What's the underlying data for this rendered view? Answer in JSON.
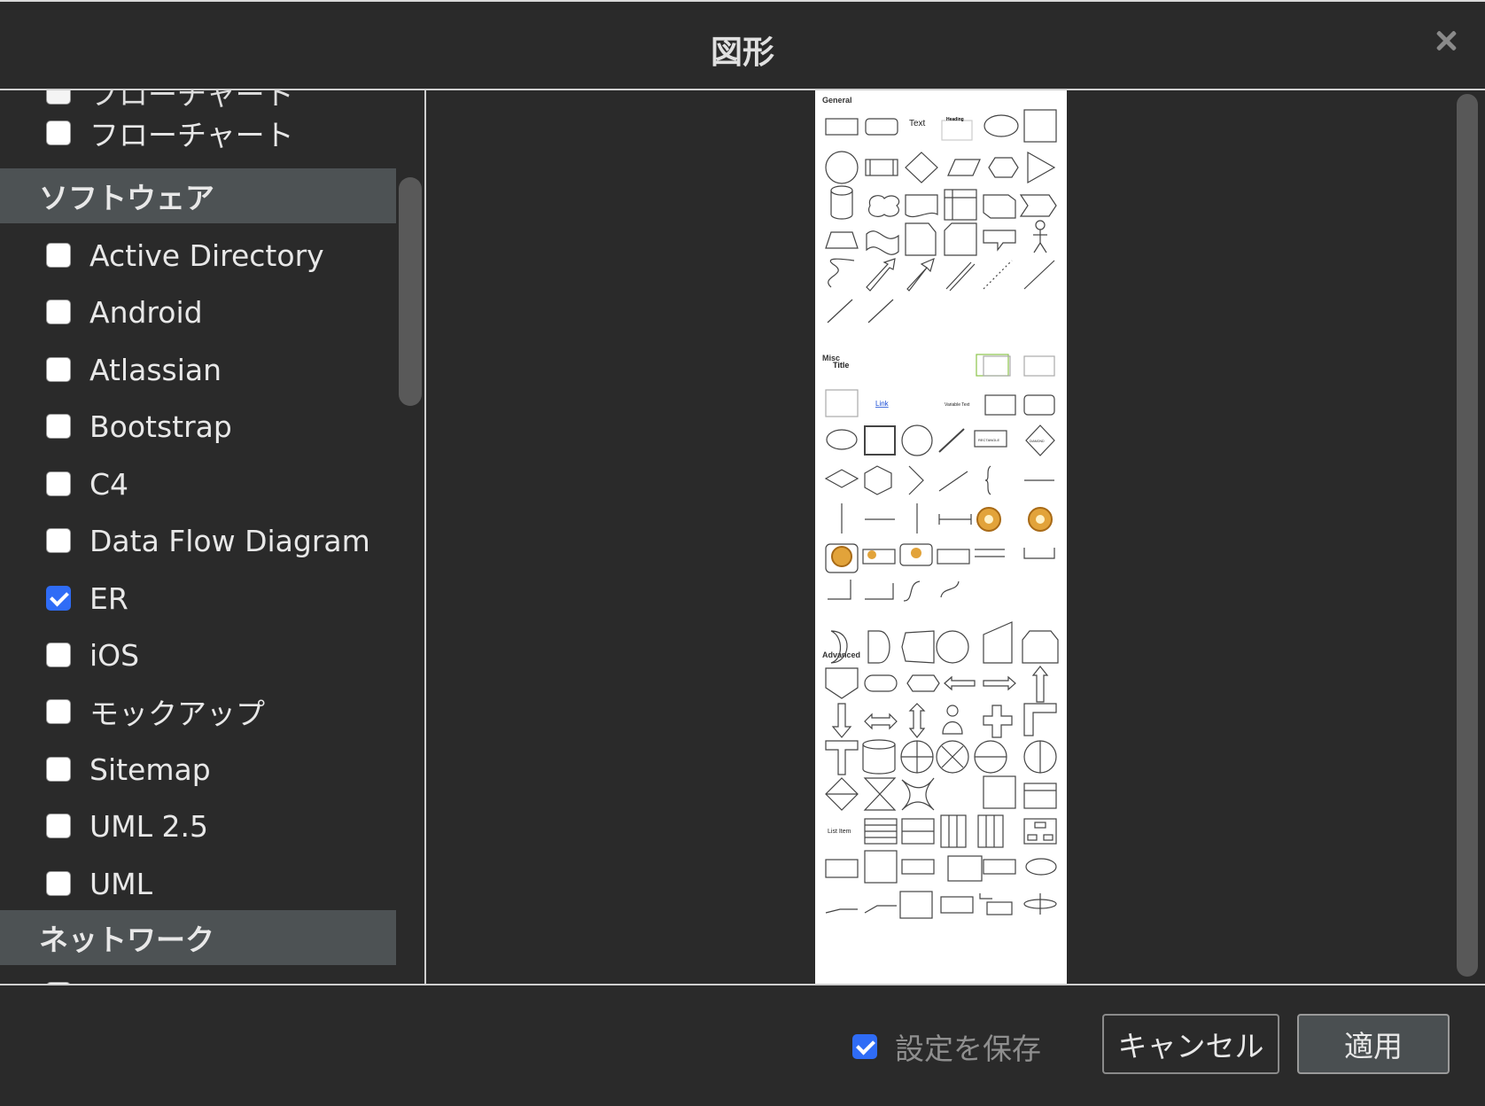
{
  "dialog": {
    "title": "図形",
    "close_label": "×"
  },
  "left_list": {
    "partial_top_item": "フローチャート",
    "items_before": [
      {
        "label": "フローチャート",
        "checked": false
      }
    ],
    "group_software": "ソフトウェア",
    "software_items": [
      {
        "label": "Active Directory",
        "checked": false
      },
      {
        "label": "Android",
        "checked": false
      },
      {
        "label": "Atlassian",
        "checked": false
      },
      {
        "label": "Bootstrap",
        "checked": false
      },
      {
        "label": "C4",
        "checked": false
      },
      {
        "label": "Data Flow Diagram",
        "checked": false
      },
      {
        "label": "ER",
        "checked": true
      },
      {
        "label": "iOS",
        "checked": false
      },
      {
        "label": "モックアップ",
        "checked": false
      },
      {
        "label": "Sitemap",
        "checked": false
      },
      {
        "label": "UML 2.5",
        "checked": false
      },
      {
        "label": "UML",
        "checked": false
      }
    ],
    "group_network": "ネットワーク"
  },
  "preview": {
    "sections": [
      "General",
      "Misc",
      "Advanced"
    ],
    "general_text": "Text",
    "general_heading": "Heading",
    "misc_title": "Title",
    "misc_link": "Link",
    "misc_variable": "Variable Text",
    "misc_rectangle": "RECTANGLE",
    "misc_diamond": "DIAMOND",
    "advanced_list_item": "List Item"
  },
  "footer": {
    "save_settings_label": "設定を保存",
    "save_settings_checked": true,
    "cancel_label": "キャンセル",
    "apply_label": "適用"
  }
}
